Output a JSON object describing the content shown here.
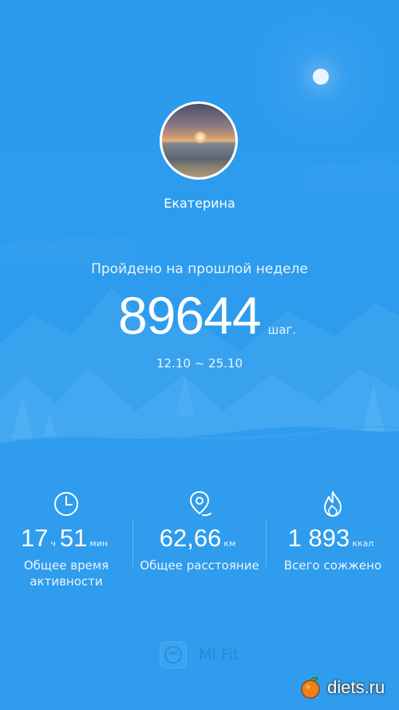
{
  "profile": {
    "name": "Екатерина"
  },
  "summary": {
    "label": "Пройдено на прошлой неделе",
    "steps": "89644",
    "steps_unit": "шаг.",
    "date_range": "12.10 ~ 25.10"
  },
  "stats": {
    "activity": {
      "icon": "clock-icon",
      "hours": "17",
      "hours_unit": "ч",
      "minutes": "51",
      "minutes_unit": "мин",
      "label_line1": "Общее время",
      "label_line2": "активности"
    },
    "distance": {
      "icon": "location-pin-icon",
      "value": "62,66",
      "unit": "км",
      "label": "Общее расстояние"
    },
    "calories": {
      "icon": "flame-icon",
      "value": "1 893",
      "unit": "ккал",
      "label": "Всего сожжено"
    }
  },
  "brand": {
    "logo_text": "mi",
    "name": "Mi Fit"
  },
  "watermark": {
    "text": "diets.ru"
  },
  "colors": {
    "background": "#2d9aee",
    "brand_text": "#2688d4"
  }
}
